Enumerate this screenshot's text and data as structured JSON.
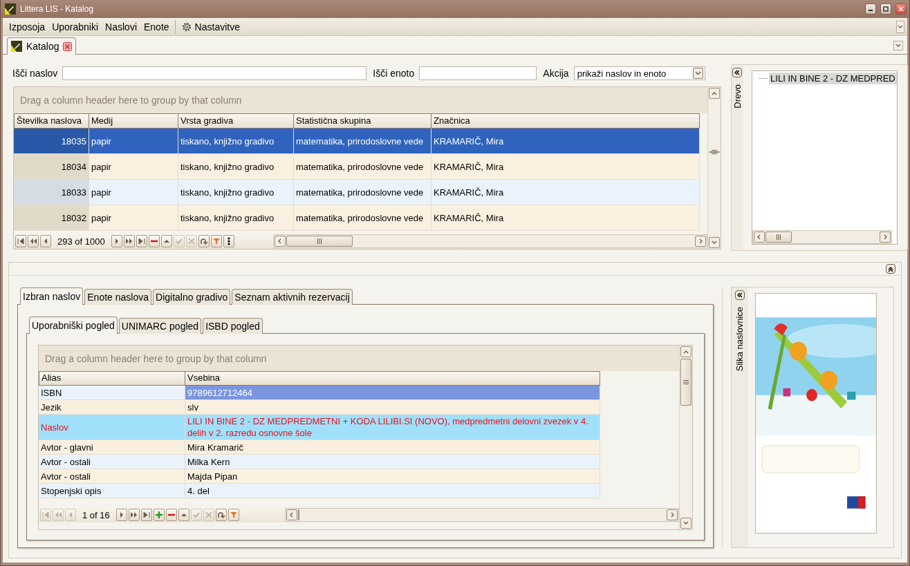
{
  "window": {
    "title": "Littera LIS - Katalog"
  },
  "menu": [
    {
      "label": "Izposoja",
      "kind": "plain"
    },
    {
      "label": "Uporabniki",
      "kind": "plain"
    },
    {
      "label": "Naslovi",
      "kind": "plain"
    },
    {
      "label": "Enote",
      "kind": "plain"
    },
    {
      "label": "Nastavitve",
      "kind": "settings"
    }
  ],
  "document_tabs": [
    {
      "label": "Katalog",
      "selected": true
    }
  ],
  "search": {
    "title_label": "Išči naslov",
    "unit_label": "Išči enoto",
    "action_label": "Akcija",
    "action_value": "prikaži naslov in enoto"
  },
  "titles_grid": {
    "group_hint": "Drag a column header here to group by that column",
    "columns": [
      "Številka naslova",
      "Medij",
      "Vrsta gradiva",
      "Statistična skupina",
      "Značnica"
    ],
    "rows": [
      {
        "selected": true,
        "cells": [
          "18035",
          "papir",
          "tiskano, knjižno gradivo",
          "matematika, prirodoslovne vede",
          "KRAMARIČ, Mira"
        ]
      },
      {
        "selected": false,
        "cells": [
          "18034",
          "papir",
          "tiskano, knjižno gradivo",
          "matematika, prirodoslovne vede",
          "KRAMARIČ, Mira"
        ]
      },
      {
        "selected": false,
        "cells": [
          "18033",
          "papir",
          "tiskano, knjižno gradivo",
          "matematika, prirodoslovne vede",
          "KRAMARIČ, Mira"
        ]
      },
      {
        "selected": false,
        "cells": [
          "18032",
          "papir",
          "tiskano, knjižno gradivo",
          "matematika, prirodoslovne vede",
          "KRAMARIČ, Mira"
        ]
      }
    ],
    "navigator": [
      {
        "kind": "first",
        "disabled": false
      },
      {
        "kind": "prev-page",
        "disabled": false
      },
      {
        "kind": "prev",
        "disabled": false
      },
      {
        "kind": "counter",
        "text": "293 of 1000"
      },
      {
        "kind": "next",
        "disabled": false
      },
      {
        "kind": "next-page",
        "disabled": false
      },
      {
        "kind": "last",
        "disabled": false
      },
      {
        "kind": "remove",
        "disabled": false
      },
      {
        "kind": "up",
        "disabled": false
      },
      {
        "kind": "check",
        "disabled": true
      },
      {
        "kind": "cancel",
        "disabled": true
      },
      {
        "kind": "refresh",
        "disabled": false
      },
      {
        "kind": "filter",
        "disabled": false
      },
      {
        "kind": "more",
        "disabled": false
      }
    ]
  },
  "tree": {
    "title": "Drevo",
    "items": [
      {
        "label": "LILI IN BINE 2 - DZ MEDPRED",
        "selected": true
      }
    ]
  },
  "detail": {
    "tabs": [
      {
        "label": "Izbran naslov",
        "selected": true
      },
      {
        "label": "Enote naslova",
        "selected": false
      },
      {
        "label": "Digitalno gradivo",
        "selected": false
      },
      {
        "label": "Seznam aktivnih rezervacij",
        "selected": false
      }
    ],
    "subtabs": [
      {
        "label": "Uporabniški pogled",
        "selected": true
      },
      {
        "label": "UNIMARC pogled",
        "selected": false
      },
      {
        "label": "ISBD pogled",
        "selected": false
      }
    ],
    "grid": {
      "group_hint": "Drag a column header here to group by that column",
      "columns": [
        "Alias",
        "Vsebina"
      ],
      "rows": [
        {
          "alias": "ISBN",
          "value": "9789612712464",
          "selected": true,
          "highlighted": false
        },
        {
          "alias": "Jezik",
          "value": "slv",
          "selected": false,
          "highlighted": false
        },
        {
          "alias": "Naslov",
          "value": "LILI IN BINE 2 - DZ MEDPREDMETNI + KODA LILIBI.SI (NOVO), medpredmetni delovni zvezek v 4. delih v 2. razredu osnovne šole",
          "selected": false,
          "highlighted": true
        },
        {
          "alias": "Avtor - glavni",
          "value": "Mira Kramarič",
          "selected": false,
          "highlighted": false
        },
        {
          "alias": "Avtor - ostali",
          "value": "Milka Kern",
          "selected": false,
          "highlighted": false
        },
        {
          "alias": "Avtor - ostali",
          "value": "Majda Pipan",
          "selected": false,
          "highlighted": false
        },
        {
          "alias": "Stopenjski opis",
          "value": "4. del",
          "selected": false,
          "highlighted": false
        }
      ],
      "navigator": [
        {
          "kind": "first",
          "disabled": true
        },
        {
          "kind": "prev-page",
          "disabled": true
        },
        {
          "kind": "prev",
          "disabled": true
        },
        {
          "kind": "counter",
          "text": "1 of 16"
        },
        {
          "kind": "next",
          "disabled": false
        },
        {
          "kind": "next-page",
          "disabled": false
        },
        {
          "kind": "last",
          "disabled": false
        },
        {
          "kind": "add",
          "disabled": false
        },
        {
          "kind": "remove",
          "disabled": false
        },
        {
          "kind": "up",
          "disabled": false
        },
        {
          "kind": "check",
          "disabled": true
        },
        {
          "kind": "cancel",
          "disabled": true
        },
        {
          "kind": "refresh",
          "disabled": false
        },
        {
          "kind": "filter",
          "disabled": false
        }
      ]
    }
  },
  "cover": {
    "title": "Slika naslovnice"
  }
}
